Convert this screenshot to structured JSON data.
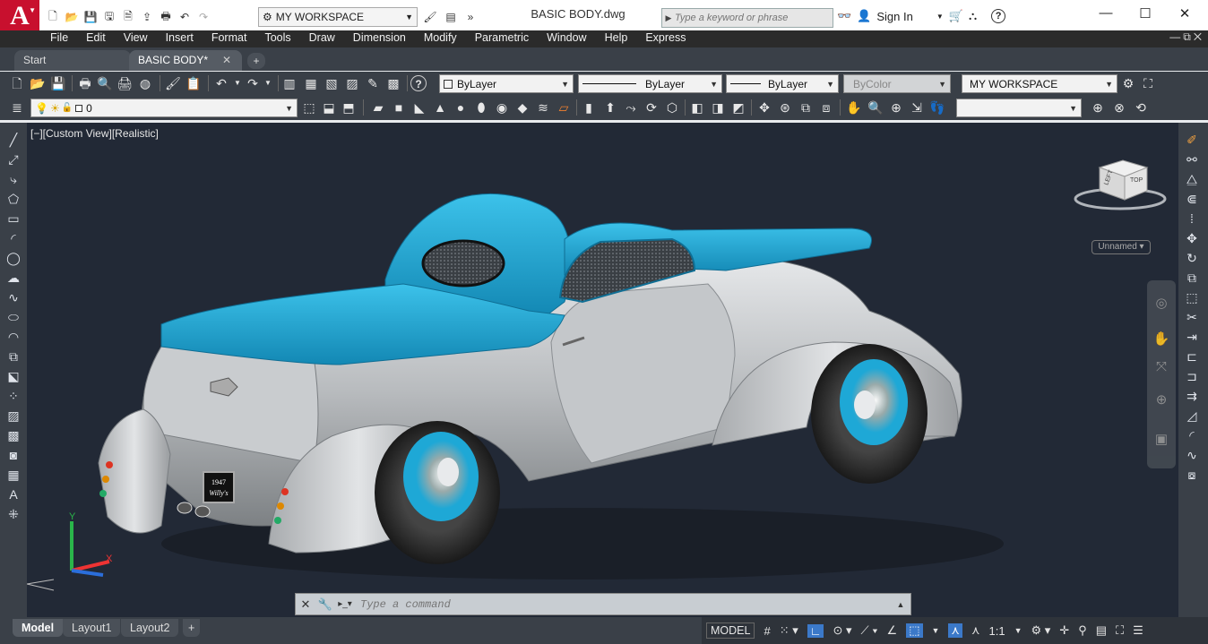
{
  "app": {
    "logo_letter": "A",
    "document_title": "BASIC BODY.dwg",
    "workspace": "MY WORKSPACE",
    "search_placeholder": "Type a keyword or phrase",
    "signin_label": "Sign In",
    "accent_color": "#c8102e"
  },
  "menu": [
    "File",
    "Edit",
    "View",
    "Insert",
    "Format",
    "Tools",
    "Draw",
    "Dimension",
    "Modify",
    "Parametric",
    "Window",
    "Help",
    "Express"
  ],
  "file_tabs": {
    "start": "Start",
    "active": "BASIC BODY*",
    "add": "+"
  },
  "properties": {
    "color": "ByLayer",
    "linetype": "ByLayer",
    "lineweight": "ByLayer",
    "plotstyle": "ByColor",
    "workspace": "MY WORKSPACE",
    "layer": "0"
  },
  "viewport": {
    "label": "[−][Custom View][Realistic]",
    "viewcube_left": "LEFT",
    "viewcube_top": "TOP",
    "view_name": "Unnamed",
    "plate_line1": "1947",
    "plate_line2": "Willy's",
    "ucs_x": "X",
    "ucs_y": "Y",
    "body_color": "#1e9cc6",
    "metal_color": "#c8cacc"
  },
  "command": {
    "placeholder": "Type a command"
  },
  "layout_tabs": [
    "Model",
    "Layout1",
    "Layout2",
    "+"
  ],
  "status": {
    "model": "MODEL",
    "scale": "1:1"
  }
}
